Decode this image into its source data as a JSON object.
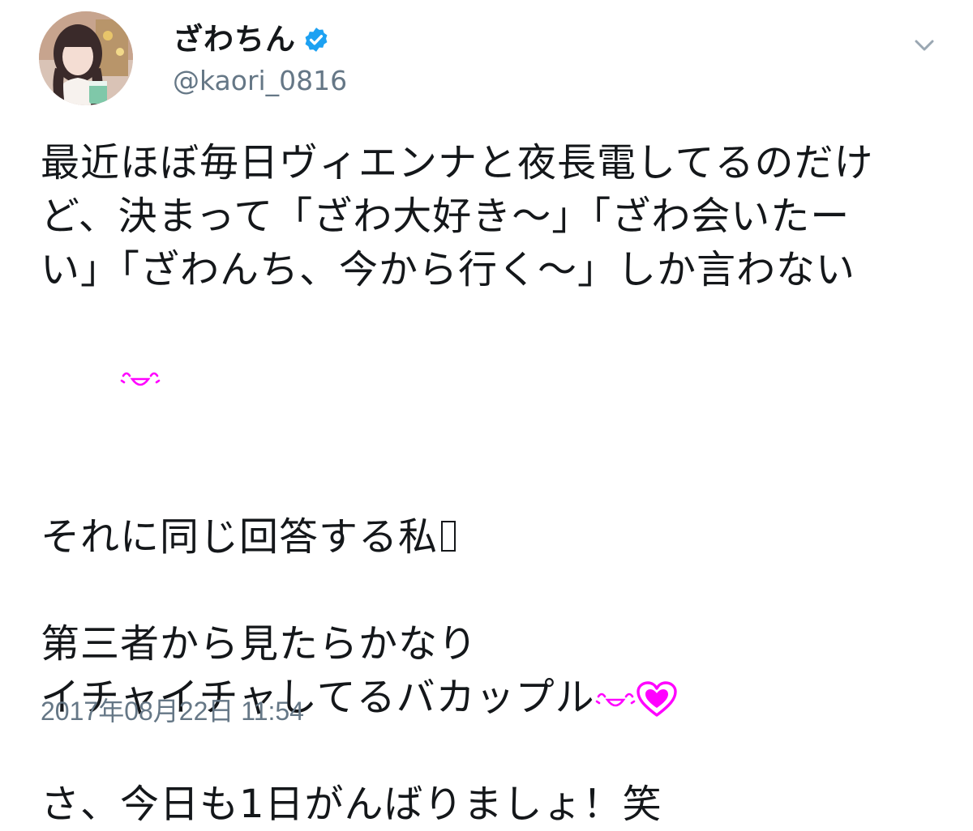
{
  "author": {
    "display_name": "ざわちん",
    "handle": "@kaori_0816",
    "verified": true,
    "avatar_icon": "profile-photo"
  },
  "menu": {
    "icon": "chevron-down-icon"
  },
  "tweet": {
    "para1_line1": "最近ほぼ毎日ヴィエンナと夜長電してるのだけ",
    "para1_line2": "ど、決まって「ざわ大好き～」「ざわ会いたー",
    "para1_line3": "い」「ざわんち、今から行く～」しか言わない",
    "para2": "それに同じ回答する私",
    "para3_line1": "第三者から見たらかなり",
    "para3_line2": "イチャイチャしてるバカップル",
    "para4": "さ、今日も1日がんばりましょ！笑",
    "timestamp": "2017年08月22日 11:54"
  },
  "colors": {
    "text": "#14171a",
    "secondary": "#657786",
    "verified_blue": "#1da1f2",
    "emoji_magenta": "#ff00ff"
  }
}
